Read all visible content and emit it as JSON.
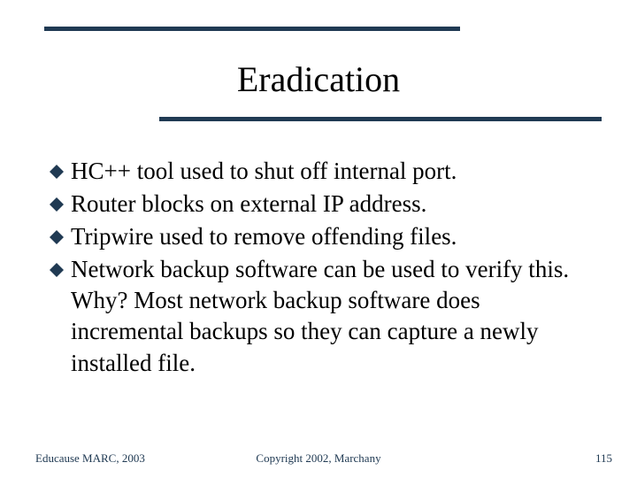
{
  "slide": {
    "title": "Eradication",
    "bullets": [
      "HC++ tool used to shut off internal port.",
      "Router blocks on external IP address.",
      "Tripwire used to remove offending files.",
      "Network backup software can be used to verify this. Why? Most network backup software does incremental backups so they can capture a newly installed file."
    ]
  },
  "footer": {
    "left": "Educause MARC, 2003",
    "center": "Copyright 2002, Marchany",
    "right": "115"
  },
  "colors": {
    "accent": "#203a53"
  }
}
